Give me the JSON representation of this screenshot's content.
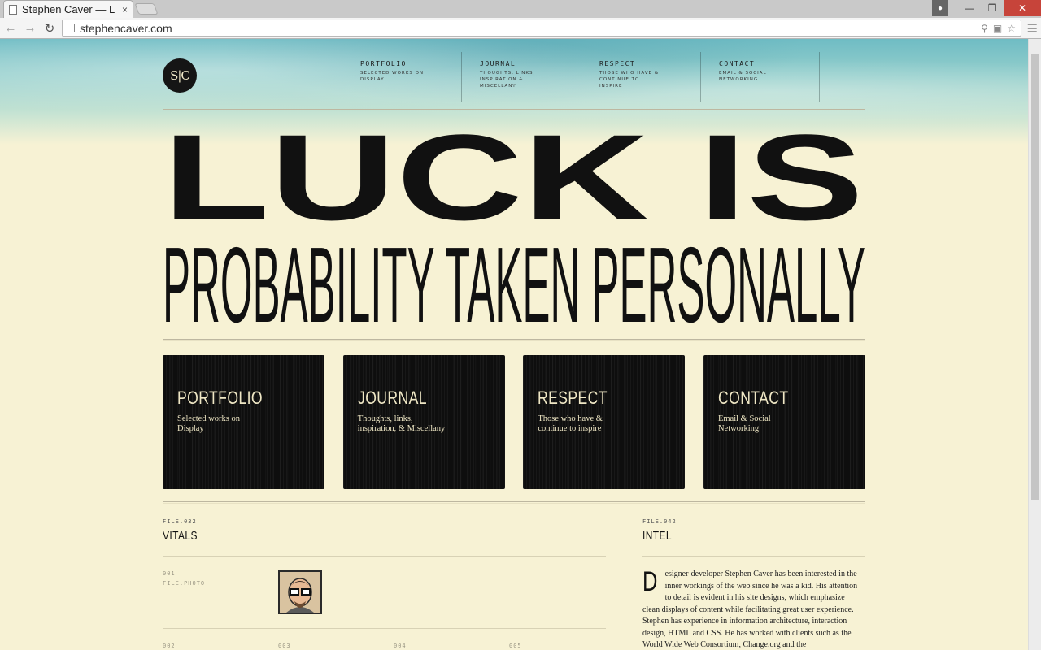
{
  "browser": {
    "tab_title": "Stephen Caver — L",
    "tab_close": "×",
    "url": "stephencaver.com"
  },
  "site": {
    "logo_text": "S|C",
    "nav": [
      {
        "title": "PORTFOLIO",
        "desc": "SELECTED WORKS ON DISPLAY"
      },
      {
        "title": "JOURNAL",
        "desc": "THOUGHTS, LINKS, INSPIRATION & MISCELLANY"
      },
      {
        "title": "RESPECT",
        "desc": "THOSE WHO HAVE & CONTINUE TO INSPIRE"
      },
      {
        "title": "CONTACT",
        "desc": "EMAIL & SOCIAL NETWORKING"
      }
    ],
    "headline_line1": "LUCK IS",
    "headline_line2": "PROBABILITY TAKEN PERSONALLY",
    "boxes": [
      {
        "title": "PORTFOLIO",
        "desc": "Selected works on Display"
      },
      {
        "title": "JOURNAL",
        "desc": "Thoughts, links, inspiration, & Miscellany"
      },
      {
        "title": "RESPECT",
        "desc": "Those who have & continue to inspire"
      },
      {
        "title": "CONTACT",
        "desc": "Email & Social Networking"
      }
    ],
    "vitals": {
      "file_label": "FILE.032",
      "title": "VITALS",
      "item_num": "001",
      "item_label": "FILE.PHOTO",
      "bottom_labels": [
        "002",
        "003",
        "004",
        "005"
      ]
    },
    "intel": {
      "file_label": "FILE.042",
      "title": "INTEL",
      "dropcap": "D",
      "text": "esigner-developer Stephen Caver has been interested in the inner workings of the web since he was a kid. His attention to detail is evident in his site designs, which emphasize clean displays of content while facilitating great user experience. Stephen has experience in information architecture, interaction design, HTML and CSS. He has worked with clients such as the World Wide Web Consortium, Change.org and the"
    }
  },
  "colors": {
    "page_bg": "#f7f2d4",
    "ink": "#111111",
    "sky": "#6fbcc4",
    "box_bg": "#0e0e0e",
    "box_text": "#efe7c5"
  }
}
